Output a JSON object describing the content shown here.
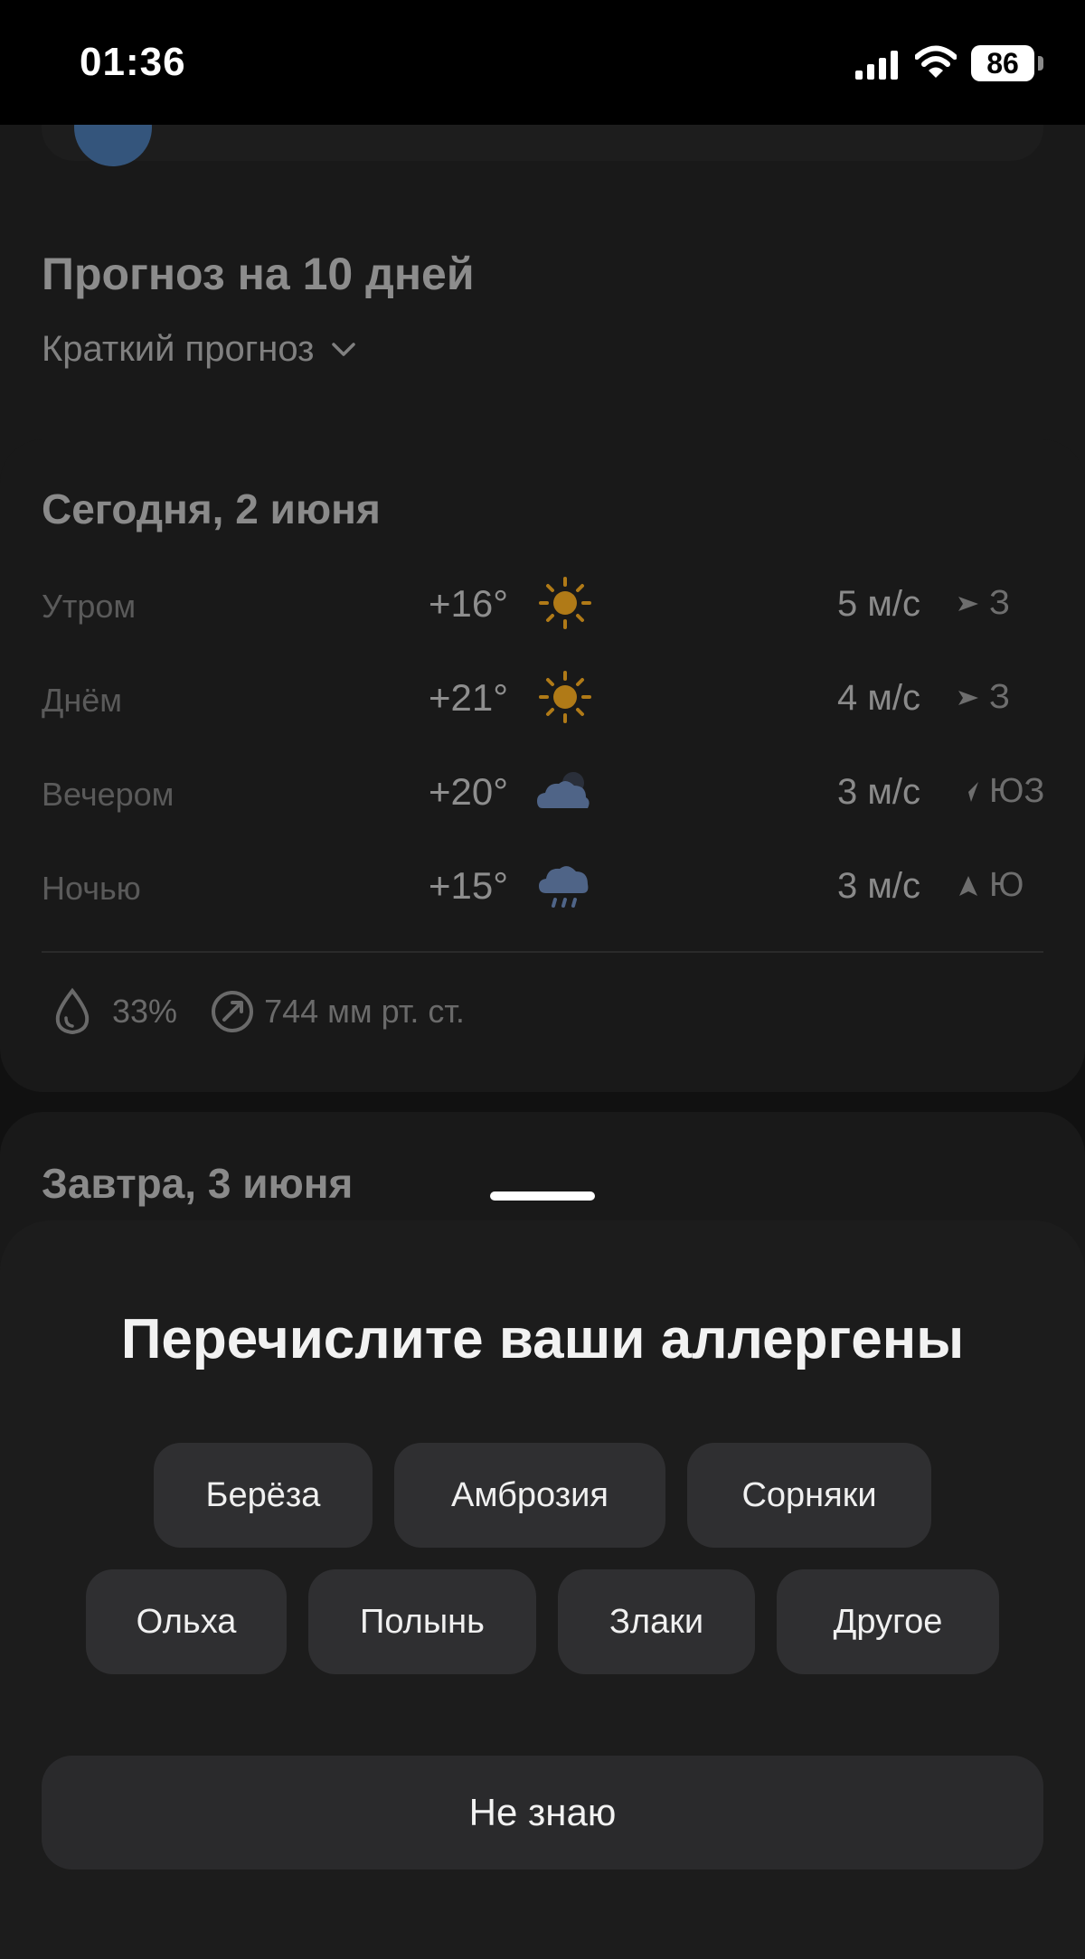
{
  "status": {
    "time": "01:36",
    "battery": "86"
  },
  "forecast": {
    "title": "Прогноз на 10 дней",
    "mode": "Краткий прогноз"
  },
  "today": {
    "title": "Сегодня, 2 июня",
    "rows": [
      {
        "period": "Утром",
        "temp": "+16°",
        "icon": "sun-icon",
        "wind": "5 м/с",
        "dir": "З"
      },
      {
        "period": "Днём",
        "temp": "+21°",
        "icon": "sun-icon",
        "wind": "4 м/с",
        "dir": "З"
      },
      {
        "period": "Вечером",
        "temp": "+20°",
        "icon": "cloudy-night-icon",
        "wind": "3 м/с",
        "dir": "ЮЗ"
      },
      {
        "period": "Ночью",
        "temp": "+15°",
        "icon": "rain-cloud-icon",
        "wind": "3 м/с",
        "dir": "Ю"
      }
    ],
    "humidity": "33%",
    "pressure": "744 мм рт. ст."
  },
  "tomorrow": {
    "title": "Завтра, 3 июня"
  },
  "sheet": {
    "title": "Перечислите ваши аллергены",
    "chips_row1": [
      "Берёза",
      "Амброзия",
      "Сорняки"
    ],
    "chips_row2": [
      "Ольха",
      "Полынь",
      "Злаки",
      "Другое"
    ],
    "unknown": "Не знаю"
  },
  "colors": {
    "sun": "#b07a17",
    "cloud": "#4f6487",
    "sheet": "#1c1c1c",
    "chip": "#2f2f31"
  }
}
